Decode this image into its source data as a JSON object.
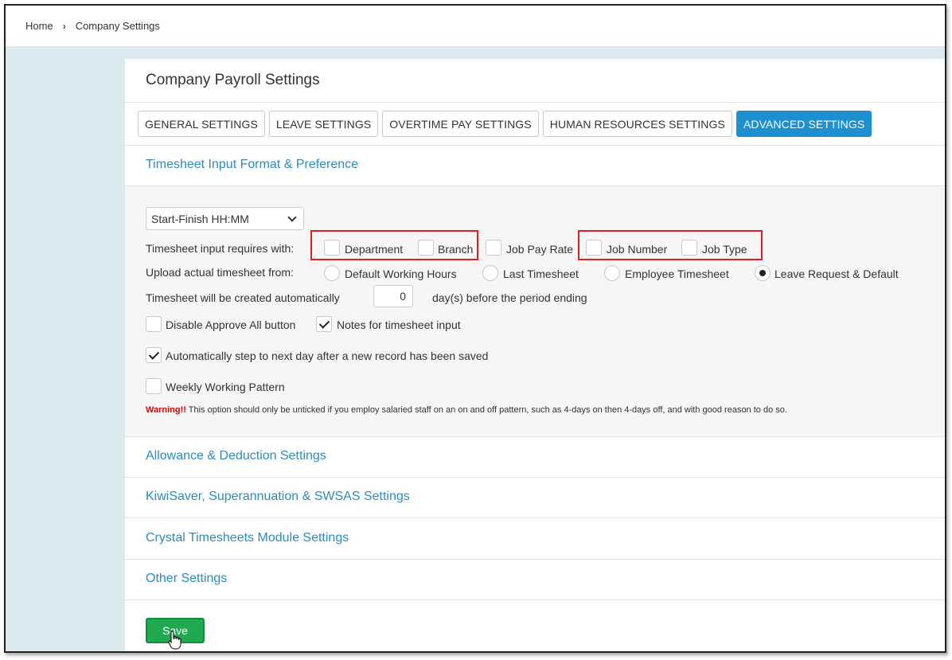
{
  "breadcrumb": {
    "home": "Home",
    "current": "Company Settings"
  },
  "page": {
    "title": "Company Payroll Settings"
  },
  "tabs": [
    {
      "label": "GENERAL SETTINGS"
    },
    {
      "label": "LEAVE SETTINGS"
    },
    {
      "label": "OVERTIME PAY SETTINGS"
    },
    {
      "label": "HUMAN RESOURCES SETTINGS"
    },
    {
      "label": "ADVANCED SETTINGS",
      "active": true
    }
  ],
  "timesheet": {
    "section_title": "Timesheet Input Format & Preference",
    "format_select": {
      "value": "Start-Finish HH:MM"
    },
    "requires_label": "Timesheet input requires with:",
    "requires_options": [
      {
        "label": "Department",
        "checked": false
      },
      {
        "label": "Branch",
        "checked": false
      },
      {
        "label": "Job Pay Rate",
        "checked": false
      },
      {
        "label": "Job Number",
        "checked": false
      },
      {
        "label": "Job Type",
        "checked": false
      }
    ],
    "upload_label": "Upload actual timesheet from:",
    "upload_options": [
      {
        "label": "Default Working Hours",
        "checked": false
      },
      {
        "label": "Last Timesheet",
        "checked": false
      },
      {
        "label": "Employee Timesheet",
        "checked": false
      },
      {
        "label": "Leave Request & Default",
        "checked": true
      }
    ],
    "auto_create_label": "Timesheet will be created automatically",
    "auto_create_days": "0",
    "auto_create_suffix": "day(s) before the period ending",
    "disable_approve_all": {
      "label": "Disable Approve All button",
      "checked": false
    },
    "notes_input": {
      "label": "Notes for timesheet input",
      "checked": true
    },
    "auto_step": {
      "label": "Automatically step to next day after a new record has been saved",
      "checked": true
    },
    "weekly_pattern": {
      "label": "Weekly Working Pattern",
      "checked": false
    },
    "warning_prefix": "Warning!!",
    "warning_text": " This option should only be unticked if you employ salaried staff on an on and off pattern, such as 4-days on then 4-days off, and with good reason to do so."
  },
  "sections": [
    {
      "title": "Allowance & Deduction Settings"
    },
    {
      "title": "KiwiSaver, Superannuation & SWSAS Settings"
    },
    {
      "title": "Crystal Timesheets Module Settings"
    },
    {
      "title": "Other Settings"
    }
  ],
  "save_label": "Save",
  "colors": {
    "accent": "#1e8fd0",
    "link": "#2a8cc6",
    "save": "#1faa4f",
    "warning": "#e00000",
    "highlight": "#e02020"
  }
}
